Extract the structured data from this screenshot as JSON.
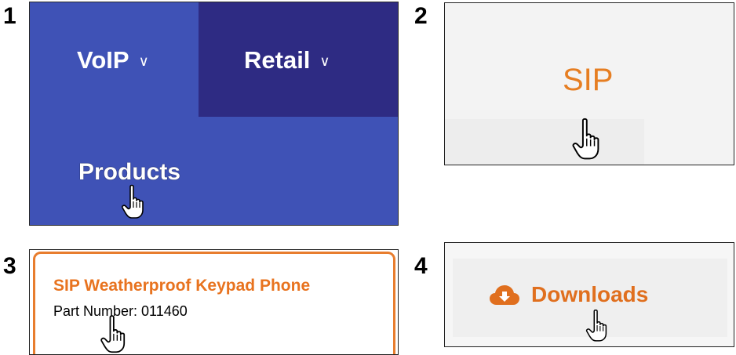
{
  "steps": [
    "1",
    "2",
    "3",
    "4"
  ],
  "nav": {
    "voip_label": "VoIP",
    "retail_label": "Retail",
    "chevron": "∨",
    "products_label": "Products"
  },
  "sip": {
    "label": "SIP"
  },
  "product_card": {
    "title": "SIP Weatherproof Keypad Phone",
    "part_number": "Part Number: 011460"
  },
  "downloads": {
    "label": "Downloads",
    "icon": "cloud-download-icon"
  },
  "colors": {
    "nav_blue": "#3f52b6",
    "nav_dark": "#2e2b83",
    "accent_orange": "#e8731f"
  }
}
